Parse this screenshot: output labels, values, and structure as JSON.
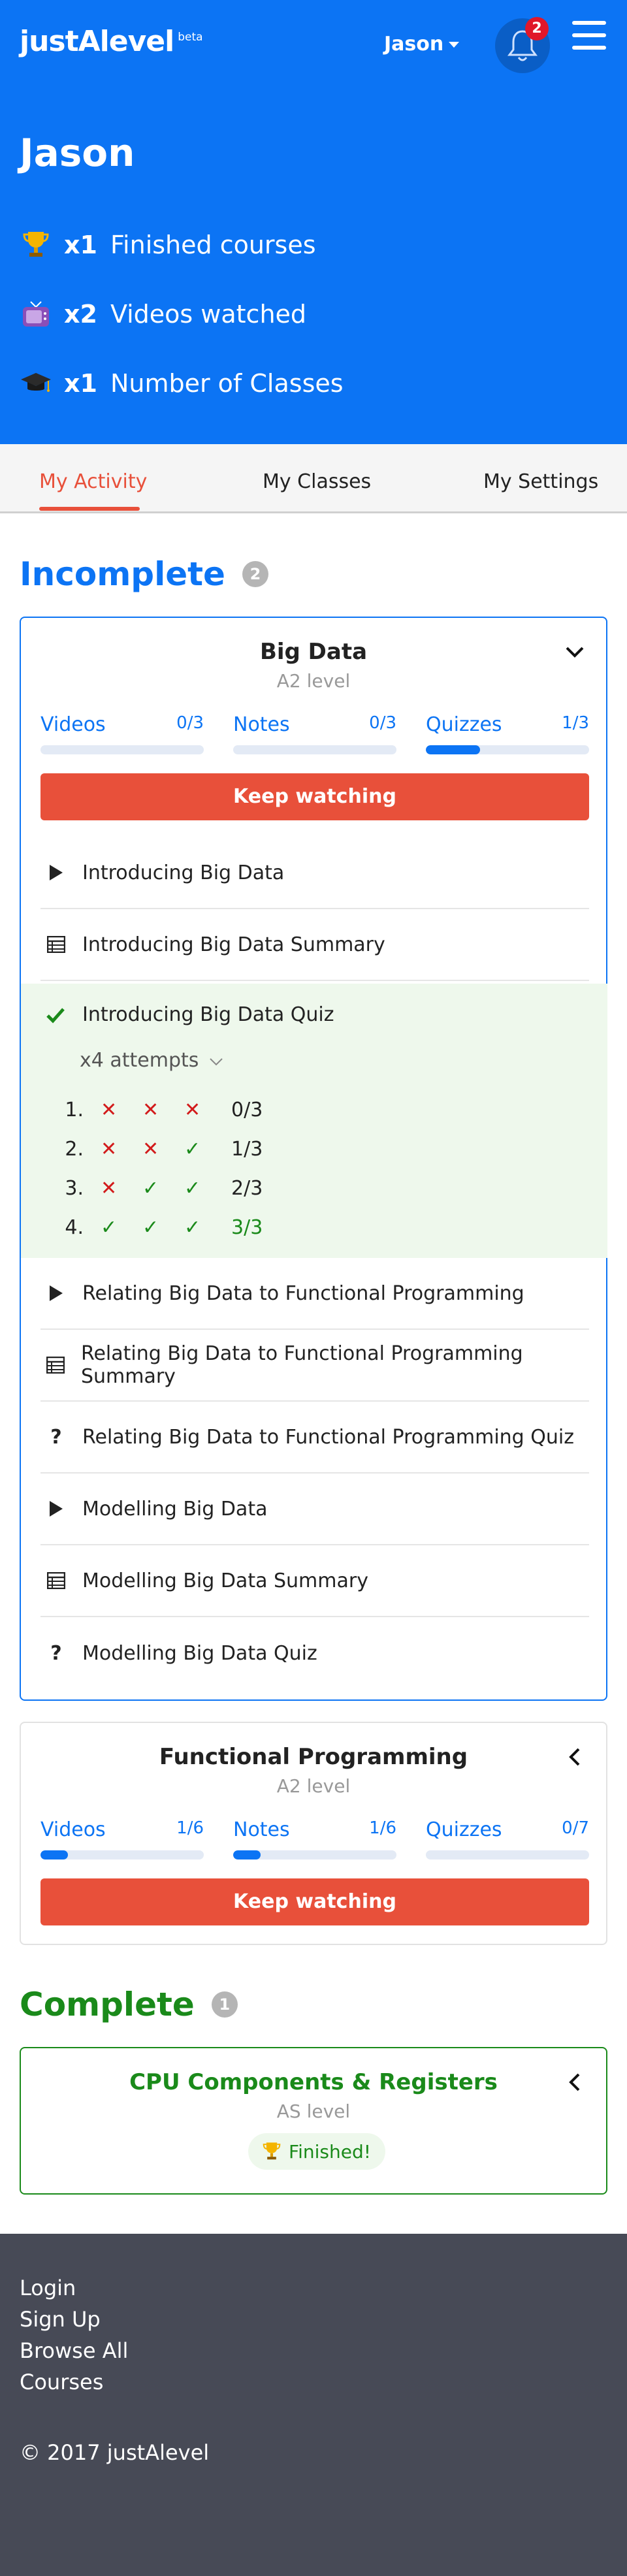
{
  "header": {
    "logo": "justAlevel",
    "logo_badge": "beta",
    "user_name": "Jason",
    "notification_count": "2"
  },
  "profile": {
    "name": "Jason",
    "stats": [
      {
        "icon": "trophy-icon",
        "count": "x1",
        "label": "Finished courses"
      },
      {
        "icon": "tv-icon",
        "count": "x2",
        "label": "Videos watched"
      },
      {
        "icon": "graduation-cap-icon",
        "count": "x1",
        "label": "Number of Classes"
      }
    ]
  },
  "tabs": [
    {
      "label": "My Activity",
      "active": true
    },
    {
      "label": "My Classes",
      "active": false
    },
    {
      "label": "My Settings",
      "active": false
    }
  ],
  "incomplete": {
    "title": "Incomplete",
    "count": "2",
    "courses": [
      {
        "title": "Big Data",
        "level": "A2 level",
        "progress": [
          {
            "label": "Videos",
            "value": "0/3",
            "fraction": 0
          },
          {
            "label": "Notes",
            "value": "0/3",
            "fraction": 0
          },
          {
            "label": "Quizzes",
            "value": "1/3",
            "fraction": 0.333
          }
        ],
        "button": "Keep watching",
        "lessons": [
          {
            "type": "video",
            "title": "Introducing Big Data"
          },
          {
            "type": "notes",
            "title": "Introducing Big Data Summary"
          },
          {
            "type": "quiz-done",
            "title": "Introducing Big Data Quiz"
          },
          {
            "type": "video",
            "title": "Relating Big Data to Functional Programming"
          },
          {
            "type": "notes",
            "title": "Relating Big Data to Functional Programming Summary"
          },
          {
            "type": "quiz",
            "title": "Relating Big Data to Functional Programming Quiz"
          },
          {
            "type": "video",
            "title": "Modelling Big Data"
          },
          {
            "type": "notes",
            "title": "Modelling Big Data Summary"
          },
          {
            "type": "quiz",
            "title": "Modelling Big Data Quiz"
          }
        ],
        "quiz_attempts_label": "x4 attempts",
        "attempts": [
          {
            "num": "1.",
            "marks": [
              "x",
              "x",
              "x"
            ],
            "score": "0/3"
          },
          {
            "num": "2.",
            "marks": [
              "x",
              "x",
              "ok"
            ],
            "score": "1/3"
          },
          {
            "num": "3.",
            "marks": [
              "x",
              "ok",
              "ok"
            ],
            "score": "2/3"
          },
          {
            "num": "4.",
            "marks": [
              "ok",
              "ok",
              "ok"
            ],
            "score": "3/3"
          }
        ]
      },
      {
        "title": "Functional Programming",
        "level": "A2 level",
        "progress": [
          {
            "label": "Videos",
            "value": "1/6",
            "fraction": 0.1667
          },
          {
            "label": "Notes",
            "value": "1/6",
            "fraction": 0.1667
          },
          {
            "label": "Quizzes",
            "value": "0/7",
            "fraction": 0
          }
        ],
        "button": "Keep watching"
      }
    ]
  },
  "complete": {
    "title": "Complete",
    "count": "1",
    "courses": [
      {
        "title": "CPU Components & Registers",
        "level": "AS level",
        "badge": "Finished!"
      }
    ]
  },
  "footer": {
    "links": [
      "Login",
      "Sign Up",
      "Browse All",
      "Courses"
    ],
    "copyright": "© 2017 justAlevel"
  },
  "colors": {
    "brand_blue": "#0c74f4",
    "accent_red": "#e8503a",
    "success_green": "#1a8a1a",
    "footer_bg": "#474a56"
  }
}
